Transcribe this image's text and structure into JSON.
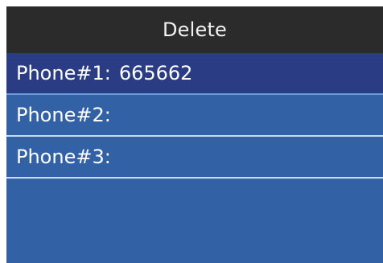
{
  "header": {
    "title": "Delete"
  },
  "list": {
    "items": [
      {
        "label": "Phone#1:",
        "value": "665662",
        "selected": true
      },
      {
        "label": "Phone#2:",
        "value": "",
        "selected": false
      },
      {
        "label": "Phone#3:",
        "value": "",
        "selected": false
      }
    ]
  },
  "colors": {
    "header_bg": "#2b2b2b",
    "screen_bg": "#3261a6",
    "selected_bg": "#2a3c84",
    "text": "#ffffff"
  }
}
